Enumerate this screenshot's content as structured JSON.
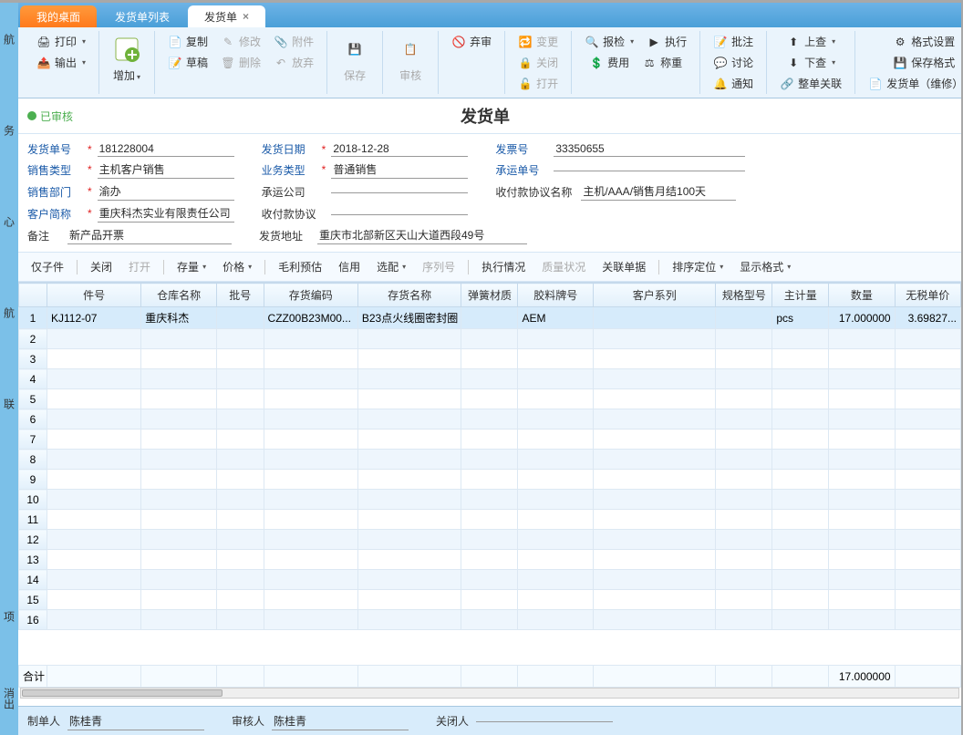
{
  "tabs": [
    {
      "label": "我的桌面",
      "type": "orange",
      "closable": false
    },
    {
      "label": "发货单列表",
      "type": "normal",
      "closable": false
    },
    {
      "label": "发货单",
      "type": "active",
      "closable": true
    }
  ],
  "ribbon": {
    "print": "打印",
    "export": "输出",
    "add": "增加",
    "copy": "复制",
    "draft": "草稿",
    "modify": "修改",
    "delete": "删除",
    "attach": "附件",
    "discard": "放弃",
    "save": "保存",
    "audit": "审核",
    "abandon": "弃审",
    "change": "变更",
    "close": "关闭",
    "open": "打开",
    "inspect": "报检",
    "feeuse": "费用",
    "exec": "执行",
    "weigh": "称重",
    "approve": "批注",
    "discuss": "讨论",
    "notify": "通知",
    "up": "上查",
    "down": "下查",
    "linkall": "整单关联",
    "fmtset": "格式设置",
    "savfmt": "保存格式",
    "shipmx": "发货单（维修）B"
  },
  "status": "已审核",
  "doc_title": "发货单",
  "form": {
    "shipNoLbl": "发货单号",
    "shipNo": "181228004",
    "saleTypeLbl": "销售类型",
    "saleType": "主机客户销售",
    "saleDeptLbl": "销售部门",
    "saleDept": "渝办",
    "custLbl": "客户简称",
    "cust": "重庆科杰实业有限责任公司",
    "remarkLbl": "备注",
    "remark": "新产品开票",
    "shipDateLbl": "发货日期",
    "shipDate": "2018-12-28",
    "bizTypeLbl": "业务类型",
    "bizType": "普通销售",
    "carrierLbl": "承运公司",
    "carrier": "",
    "payAgrLbl": "收付款协议",
    "payAgr": "",
    "shipAddrLbl": "发货地址",
    "shipAddr": "重庆市北部新区天山大道西段49号",
    "invNoLbl": "发票号",
    "invNo": "33350655",
    "carrierNoLbl": "承运单号",
    "carrierNo": "",
    "payNameLbl": "收付款协议名称",
    "payName": "主机/AAA/销售月结100天"
  },
  "tb2": {
    "only": "仅子件",
    "close": "关闭",
    "open": "打开",
    "stock": "存量",
    "price": "价格",
    "gross": "毛利预估",
    "credit": "信用",
    "match": "选配",
    "serial": "序列号",
    "exec": "执行情况",
    "qual": "质量状况",
    "link": "关联单据",
    "sort": "排序定位",
    "disp": "显示格式"
  },
  "cols": [
    "件号",
    "仓库名称",
    "批号",
    "存货编码",
    "存货名称",
    "弹簧材质",
    "胶料牌号",
    "客户系列",
    "规格型号",
    "主计量",
    "数量",
    "无税单价"
  ],
  "rows": [
    {
      "pn": "KJ112-07",
      "wh": "重庆科杰",
      "batch": "",
      "code": "CZZ00B23M00...",
      "name": "B23点火线圈密封圈",
      "spring": "",
      "glue": "AEM",
      "series": "",
      "spec": "",
      "uom": "pcs",
      "qty": "17.000000",
      "price": "3.69827..."
    }
  ],
  "sumLabel": "合计",
  "sumQty": "17.000000",
  "footer": {
    "makerLbl": "制单人",
    "maker": "陈桂青",
    "auditorLbl": "审核人",
    "auditor": "陈桂青",
    "closerLbl": "关闭人",
    "closer": ""
  }
}
